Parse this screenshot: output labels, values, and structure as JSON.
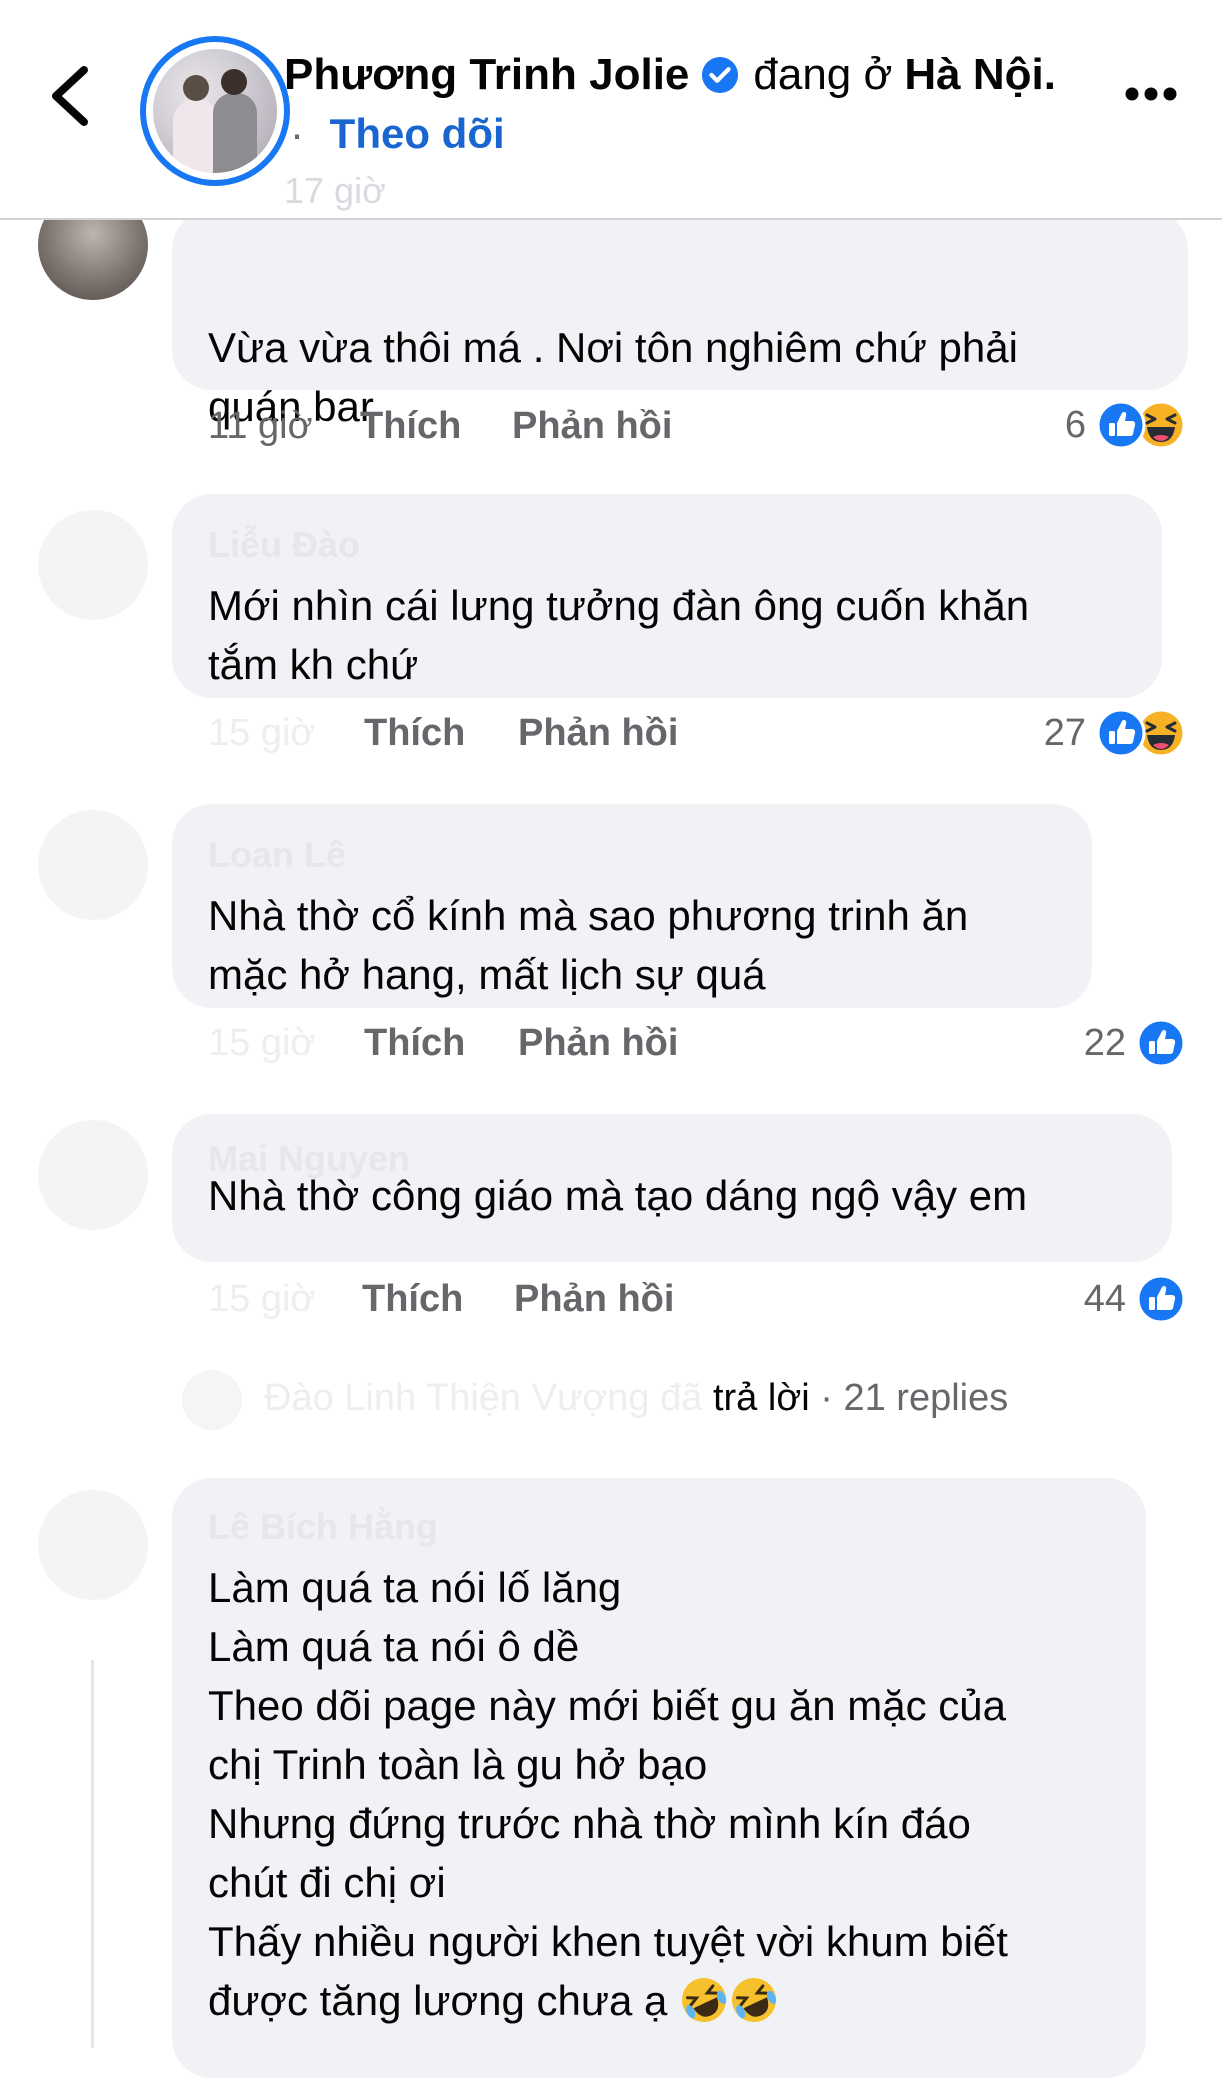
{
  "header": {
    "page_name": "Phương Trinh Jolie",
    "location_prefix": "đang ở",
    "location": "Hà Nội.",
    "separator": "·",
    "follow_label": "Theo dõi",
    "post_time": "17 giờ"
  },
  "comments": [
    {
      "author": "",
      "text": "Vừa vừa thôi má . Nơi tôn nghiêm chứ    phải\nquán bar",
      "time": "11 giờ",
      "like_label": "Thích",
      "reply_label": "Phản hồi",
      "reaction_count": "6",
      "reactions": [
        "like-icon",
        "haha-icon"
      ]
    },
    {
      "author": "Liễu Đào",
      "text": "Mới nhìn cái lưng tưởng đàn ông cuốn khăn\ntắm kh chứ",
      "time": "15 giờ",
      "like_label": "Thích",
      "reply_label": "Phản hồi",
      "reaction_count": "27",
      "reactions": [
        "like-icon",
        "haha-icon"
      ]
    },
    {
      "author": "Loan Lê",
      "text": "Nhà thờ cổ kính mà sao phương trinh ăn\nmặc hở hang, mất lịch sự quá",
      "time": "15 giờ",
      "like_label": "Thích",
      "reply_label": "Phản hồi",
      "reaction_count": "22",
      "reactions": [
        "like-icon"
      ]
    },
    {
      "author": "Mai Nguyen",
      "text": "Nhà thờ công giáo mà tạo dáng ngộ vậy em",
      "time": "15 giờ",
      "like_label": "Thích",
      "reply_label": "Phản hồi",
      "reaction_count": "44",
      "reactions": [
        "like-icon"
      ],
      "replies": {
        "replier_faded": "Đào Linh Thiện Vượng đã",
        "action": "trả lời",
        "count": "· 21 replies"
      }
    },
    {
      "author": "Lê Bích Hằng",
      "text": "Làm quá ta nói lố lăng\nLàm quá ta nói ô dề\nTheo dõi page này mới biết gu ăn mặc của\nchị Trinh toàn là gu hở bạo\nNhưng đứng trước nhà thờ mình kín đáo\nchút đi chị ơi\nThấy nhiều người khen tuyệt vời khum biết\nđược tăng lương chưa ạ",
      "trailing_emoji": [
        "rofl-emoji",
        "rofl-emoji"
      ]
    }
  ],
  "colors": {
    "accent": "#1877f2",
    "follow_text": "#1a66d1",
    "bubble": "#f0f2f5",
    "meta_text": "#65676b"
  }
}
